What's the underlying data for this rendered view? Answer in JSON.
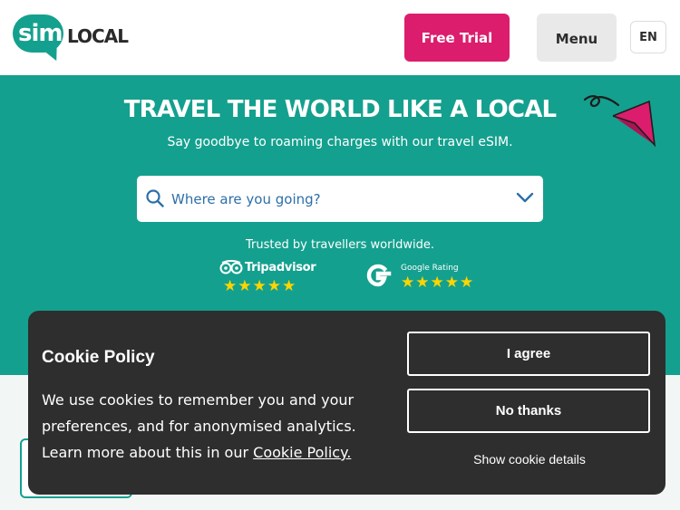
{
  "header": {
    "logo_sim": "sim",
    "logo_local": "LOCAL",
    "free_trial_label": "Free Trial",
    "menu_label": "Menu",
    "language_label": "EN"
  },
  "hero": {
    "title": "TRAVEL THE WORLD LIKE A LOCAL",
    "subtitle": "Say goodbye to roaming charges with our travel eSIM.",
    "search_placeholder": "Where are you going?",
    "trusted_text": "Trusted by travellers worldwide.",
    "tripadvisor_label": "Tripadvisor",
    "tripadvisor_stars": "★★★★★",
    "google_label": "Google Rating",
    "google_stars": "★★★★★"
  },
  "cookie": {
    "title": "Cookie Policy",
    "text": "We use cookies to remember you and your preferences, and for anonymised analytics. Learn more about this in our ",
    "link_text": "Cookie Policy.",
    "agree_label": "I agree",
    "no_thanks_label": "No thanks",
    "details_label": "Show cookie details"
  },
  "colors": {
    "brand_teal": "#14a08e",
    "accent_pink": "#dc1d6d",
    "banner_bg": "#2e2e2e",
    "star_yellow": "#ffd400"
  },
  "icons": [
    "search-icon",
    "chevron-down-icon",
    "paper-plane-icon",
    "tripadvisor-owl-icon",
    "google-g-icon"
  ]
}
